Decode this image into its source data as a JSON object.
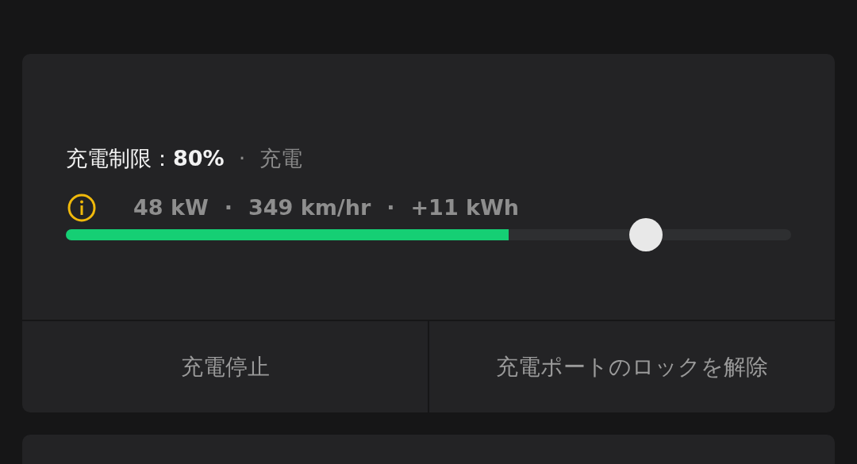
{
  "charge_limit": {
    "label": "充電制限：",
    "value": "80%",
    "separator": "·",
    "status": "充電"
  },
  "stats": {
    "items": [
      "48 kW",
      "349 km/hr",
      "+11 kWh"
    ],
    "separator": "·"
  },
  "battery_bar": {
    "level": 0.61
  },
  "limit_slider": {
    "level": 0.8
  },
  "buttons": [
    "充電停止",
    "充電ポートのロックを解除"
  ]
}
